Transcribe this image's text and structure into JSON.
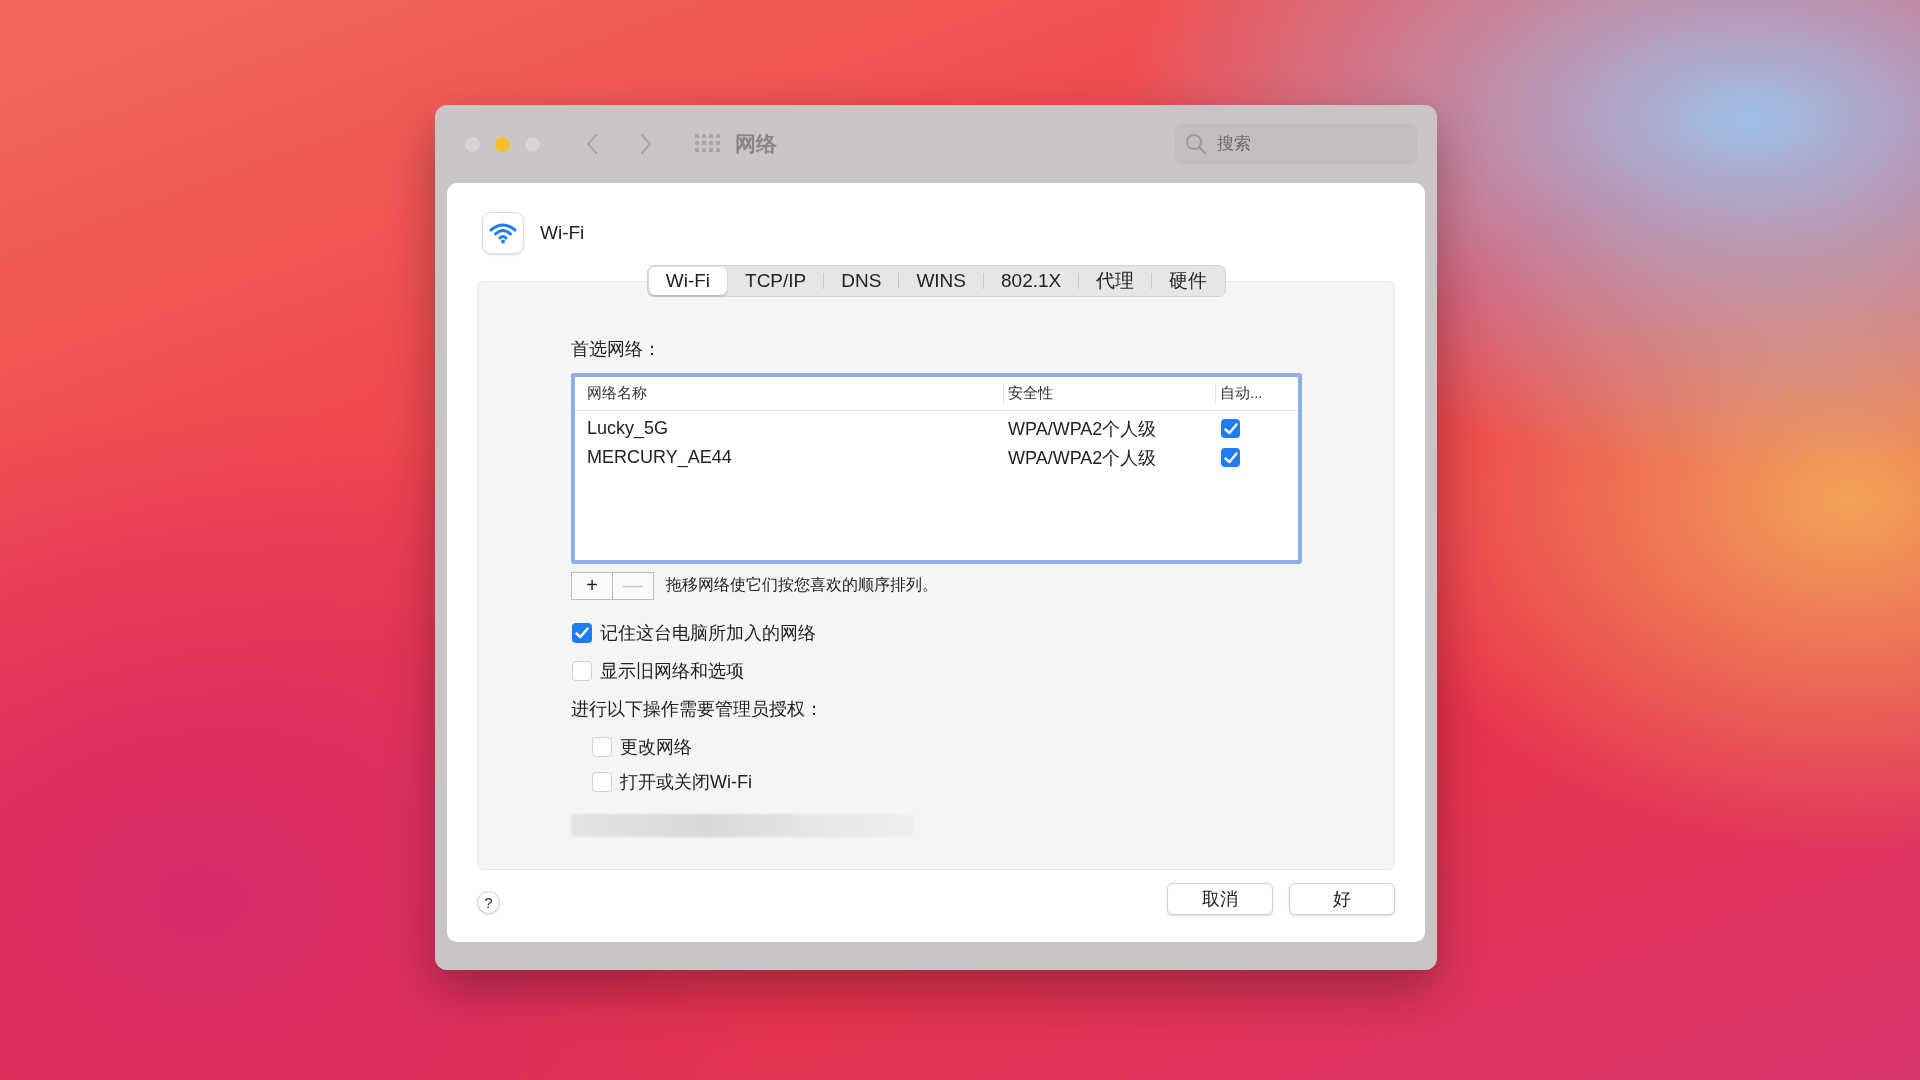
{
  "window": {
    "title": "网络",
    "search": {
      "placeholder": "搜索"
    }
  },
  "interface": {
    "name": "Wi-Fi"
  },
  "tabs": [
    {
      "label": "Wi-Fi",
      "selected": true
    },
    {
      "label": "TCP/IP",
      "selected": false
    },
    {
      "label": "DNS",
      "selected": false
    },
    {
      "label": "WINS",
      "selected": false
    },
    {
      "label": "802.1X",
      "selected": false
    },
    {
      "label": "代理",
      "selected": false
    },
    {
      "label": "硬件",
      "selected": false
    }
  ],
  "preferred_networks": {
    "label": "首选网络：",
    "columns": [
      "网络名称",
      "安全性",
      "自动..."
    ],
    "rows": [
      {
        "name": "Lucky_5G",
        "security": "WPA/WPA2个人级",
        "auto_join": true
      },
      {
        "name": "MERCURY_AE44",
        "security": "WPA/WPA2个人级",
        "auto_join": true
      }
    ],
    "add_button": {
      "label": "+",
      "disabled": false
    },
    "remove_button": {
      "label": "—",
      "disabled": true
    },
    "hint": "拖移网络使它们按您喜欢的顺序排列。"
  },
  "options": [
    {
      "label": "记住这台电脑所加入的网络",
      "checked": true
    },
    {
      "label": "显示旧网络和选项",
      "checked": false
    }
  ],
  "admin": {
    "label": "进行以下操作需要管理员授权：",
    "options": [
      {
        "label": "更改网络",
        "checked": false
      },
      {
        "label": "打开或关闭Wi-Fi",
        "checked": false
      }
    ]
  },
  "help_button": "?",
  "buttons": [
    {
      "label": "取消"
    },
    {
      "label": "好"
    }
  ]
}
